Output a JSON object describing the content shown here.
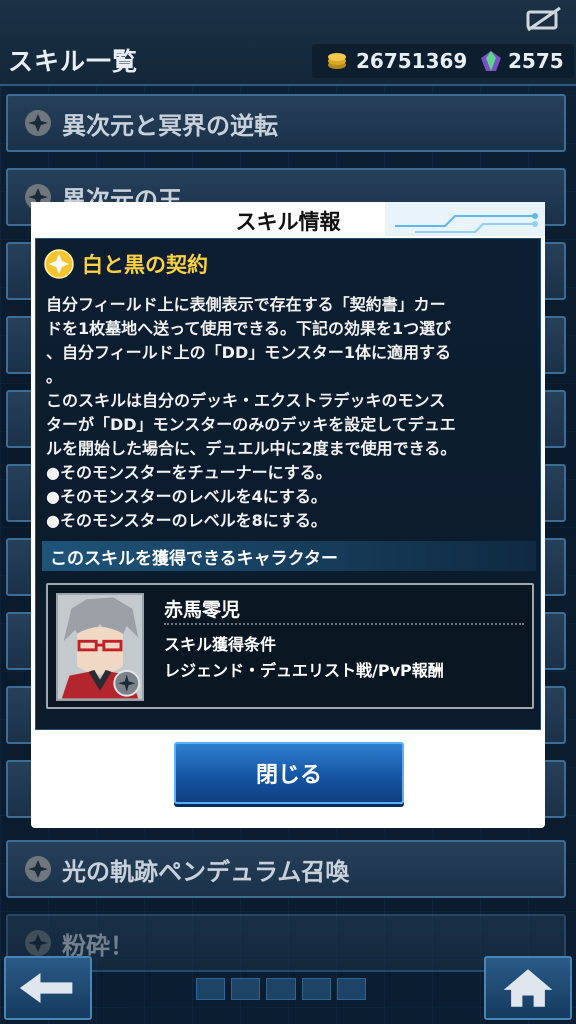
{
  "header": {
    "title": "スキル一覧",
    "gold": "26751369",
    "gems": "2575"
  },
  "skill_list": [
    {
      "label": "異次元と冥界の逆転"
    },
    {
      "label": "異次元の王"
    },
    {
      "label": "光の軌跡ペンデュラム召喚"
    },
    {
      "label": "粉砕！"
    }
  ],
  "dialog": {
    "title": "スキル情報",
    "skill_name": "白と黒の契約",
    "description_lines": [
      "自分フィールド上に表側表示で存在する「契約書」カー",
      "ドを1枚墓地へ送って使用できる。下記の効果を1つ選び",
      "、自分フィールド上の「DD」モンスター1体に適用する",
      "。",
      "このスキルは自分のデッキ・エクストラデッキのモンス",
      "ターが「DD」モンスターのみのデッキを設定してデュエ",
      "ルを開始した場合に、デュエル中に2度まで使用できる。",
      "●そのモンスターをチューナーにする。",
      "●そのモンスターのレベルを4にする。",
      "●そのモンスターのレベルを8にする。"
    ],
    "character_section_label": "このスキルを獲得できるキャラクター",
    "character": {
      "name": "赤馬零児",
      "condition_label": "スキル獲得条件",
      "condition_value": "レジェンド・デュエリスト戦/PvP報酬"
    },
    "close_label": "閉じる"
  },
  "colors": {
    "skill_name": "#ffd040",
    "button_blue": "#1656a4",
    "frame_blue": "#3c6d96"
  }
}
